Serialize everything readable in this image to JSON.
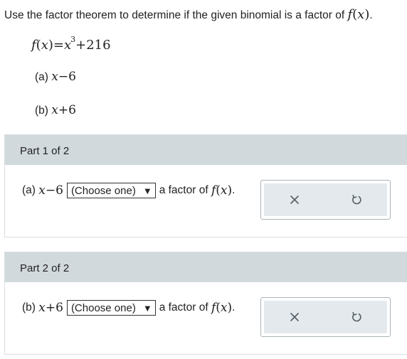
{
  "question": {
    "text": "Use the factor theorem to determine if the given binomial is a factor of",
    "func_name": "f",
    "func_var": "x",
    "end": "."
  },
  "function": {
    "lhs_name": "f",
    "lhs_var": "x",
    "eq": "=",
    "base": "x",
    "exponent": "3",
    "rest": "+216"
  },
  "binomials": [
    {
      "label": "(a)",
      "var": "x",
      "op": "−",
      "num": "6"
    },
    {
      "label": "(b)",
      "var": "x",
      "op": "+",
      "num": "6"
    }
  ],
  "parts": [
    {
      "header": "Part 1 of 2",
      "label": "(a)",
      "var": "x",
      "op": "−",
      "num": "6",
      "select_value": "(Choose one)",
      "after_text": "a factor of",
      "func_name": "f",
      "func_var": "x",
      "end": "."
    },
    {
      "header": "Part 2 of 2",
      "label": "(b)",
      "var": "x",
      "op": "+",
      "num": "6",
      "select_value": "(Choose one)",
      "after_text": "a factor of",
      "func_name": "f",
      "func_var": "x",
      "end": "."
    }
  ],
  "icons": {
    "clear": "close-icon",
    "reset": "undo-icon"
  },
  "colors": {
    "header_bg": "#d1d9dd",
    "tool_bg": "#e3e9ec",
    "tool_border": "#a9b4ba",
    "icon": "#555f66"
  }
}
